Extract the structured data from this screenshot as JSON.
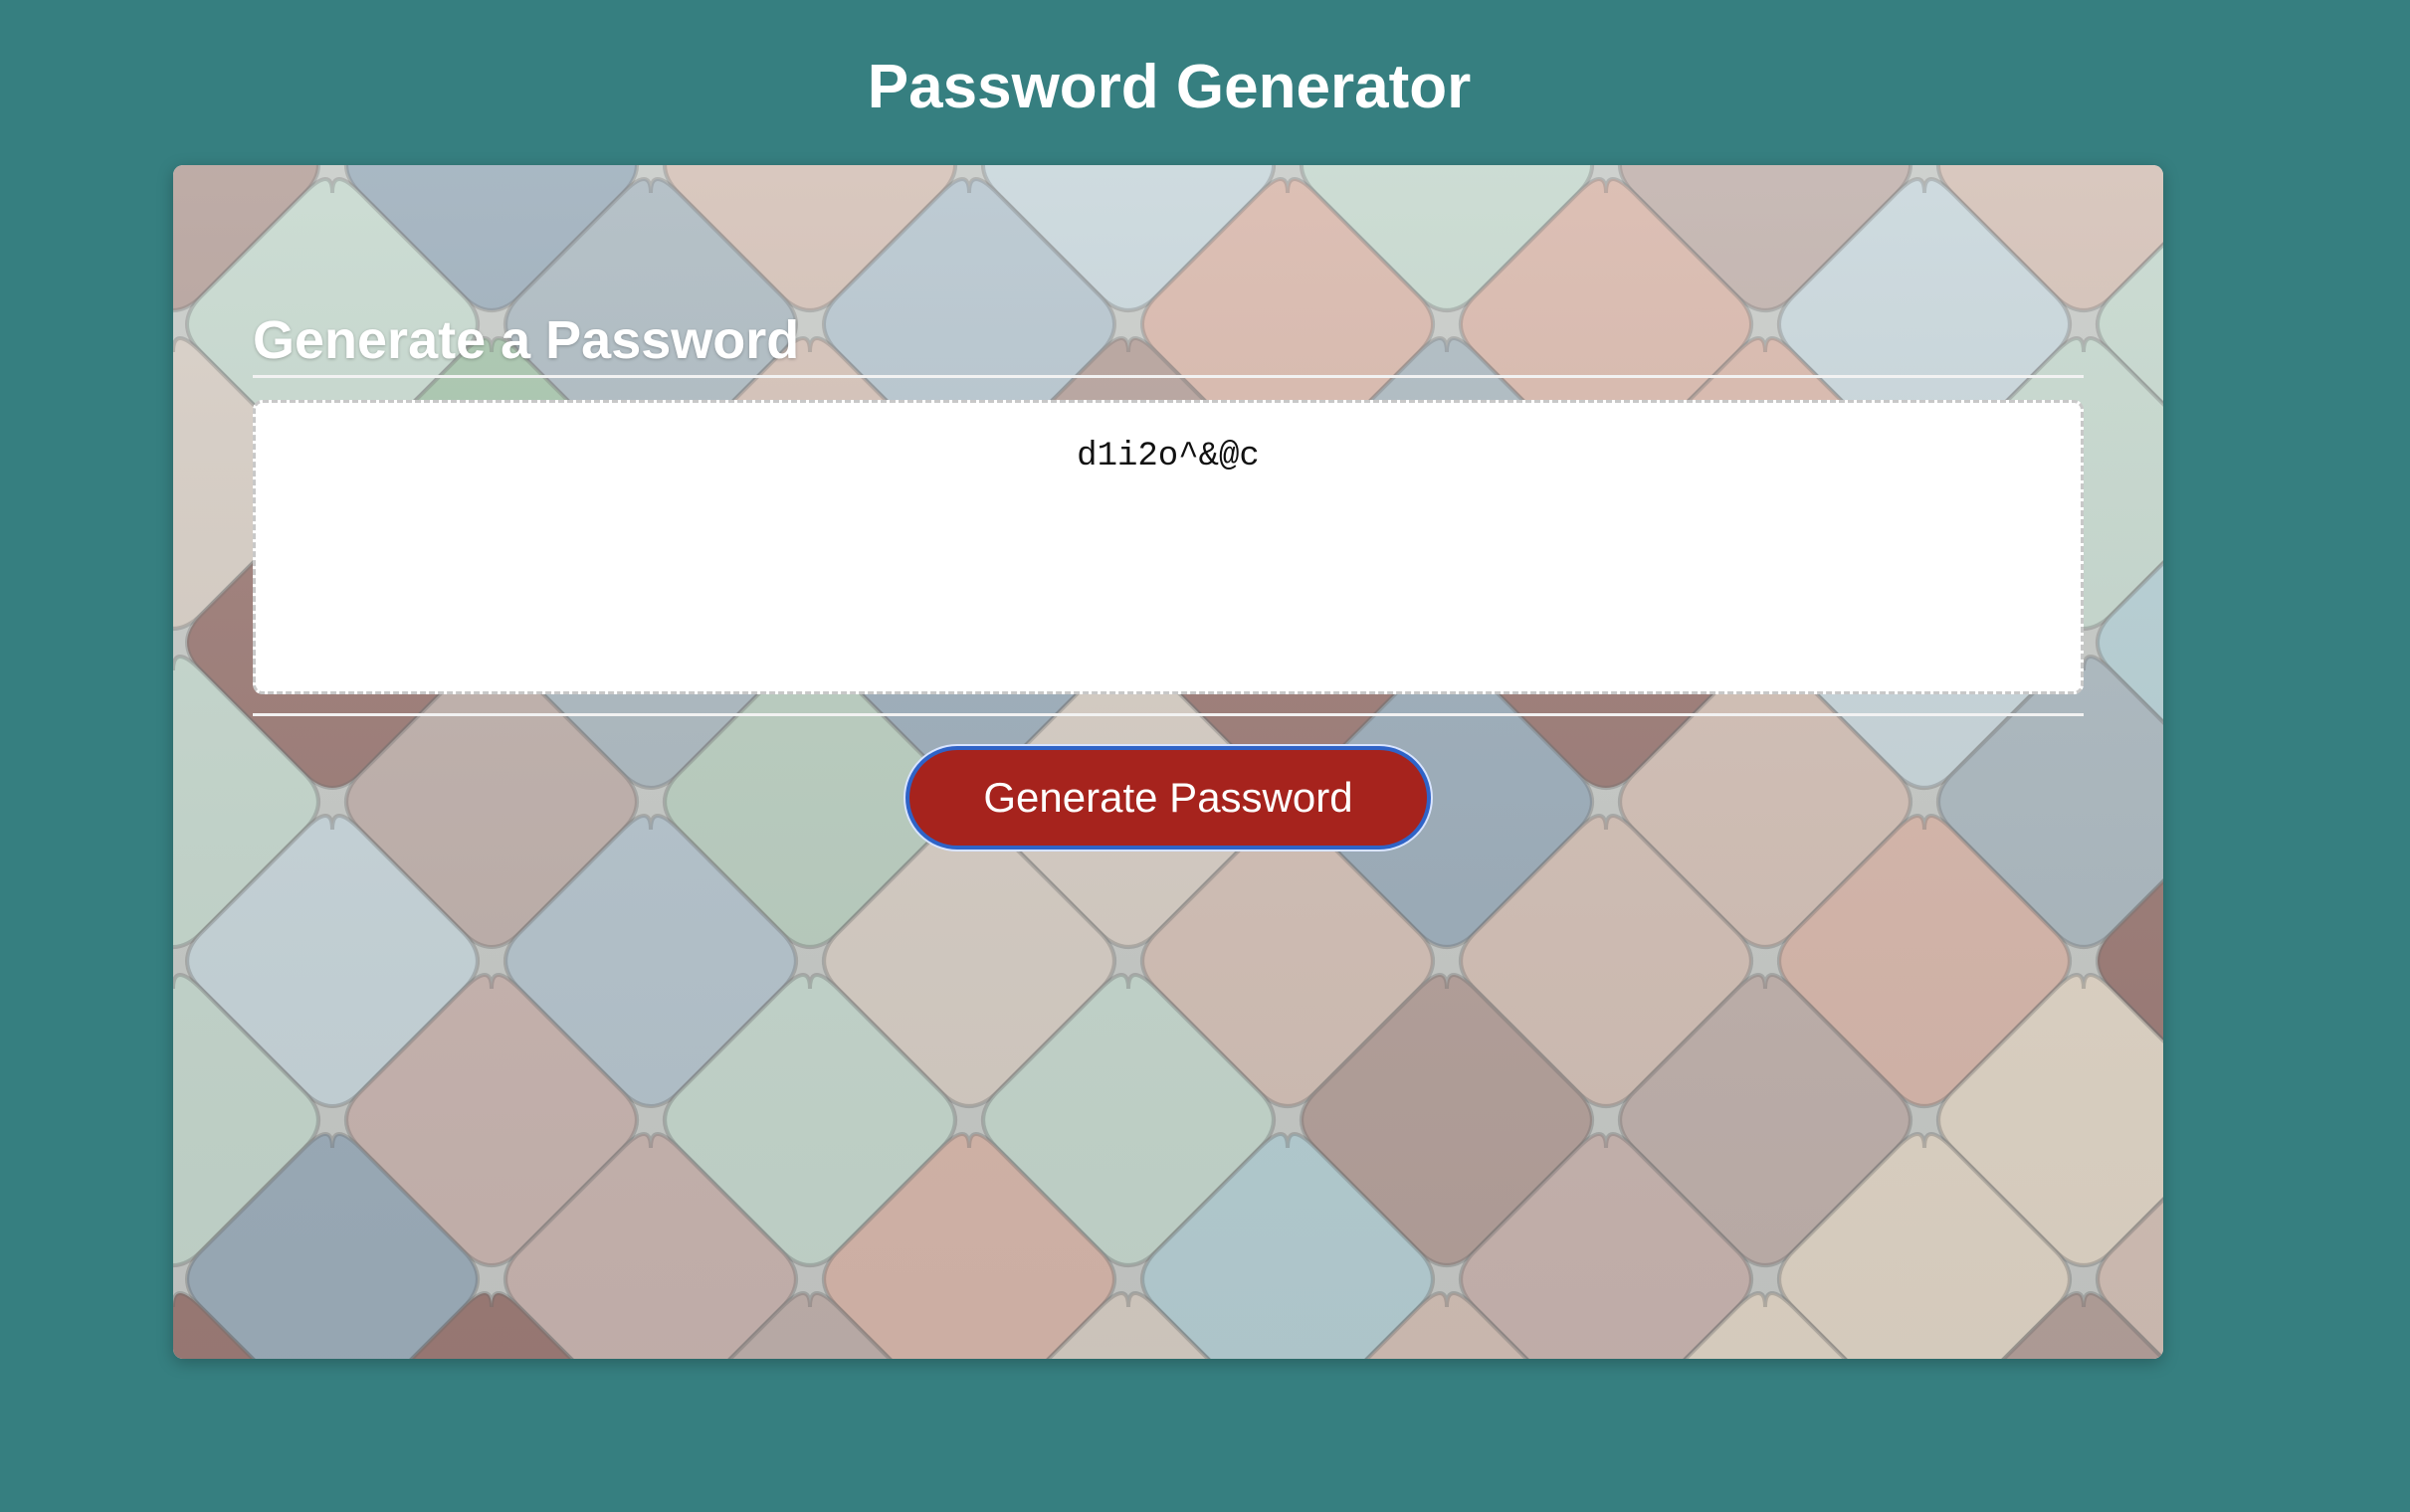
{
  "page": {
    "title": "Password Generator"
  },
  "card": {
    "header": "Generate a Password",
    "password_value": "d1i2o^&@c",
    "generate_button_label": "Generate Password"
  },
  "colors": {
    "page_background": "#367f80",
    "button_background": "#a6231d",
    "button_text": "#ffffff",
    "focus_ring": "#2f63c7"
  }
}
